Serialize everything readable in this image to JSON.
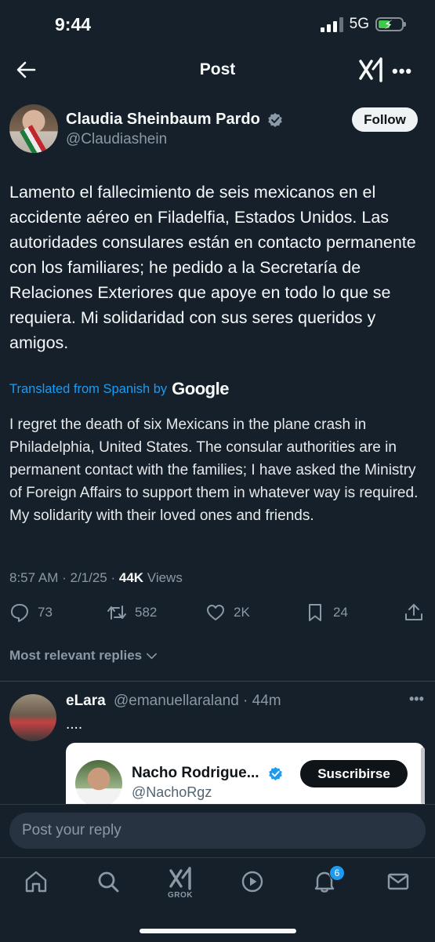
{
  "status_bar": {
    "time": "9:44",
    "network": "5G"
  },
  "header": {
    "title": "Post"
  },
  "post": {
    "author_name": "Claudia Sheinbaum Pardo",
    "author_handle": "@Claudiashein",
    "follow_label": "Follow",
    "text": "Lamento el fallecimiento de seis mexicanos en el accidente aéreo en Filadelfia, Estados Unidos. Las autoridades consulares están en contacto permanente con los familiares; he pedido a la Secretaría de Relaciones Exteriores que apoye en todo lo que se requiera. Mi solidaridad con sus seres queridos y amigos.",
    "translated_label": "Translated from Spanish by",
    "translator_brand": "Google",
    "translation": "I regret the death of six Mexicans in the plane crash in Philadelphia, United States. The consular authorities are in permanent contact with the families; I have asked the Ministry of Foreign Affairs to support them in whatever way is required. My solidarity with their loved ones and friends.",
    "time": "8:57 AM",
    "date": "2/1/25",
    "views_count": "44K",
    "views_label": "Views",
    "replies": "73",
    "reposts": "582",
    "likes": "2K",
    "bookmarks": "24"
  },
  "replies_sort_label": "Most relevant replies",
  "reply": {
    "name": "eLara",
    "handle_time": "@emanuellaraland · 44m",
    "text": "....",
    "embed": {
      "name": "Nacho Rodrigue...",
      "handle": "@NachoRgz",
      "button_label": "Suscribirse"
    }
  },
  "composer": {
    "placeholder": "Post your reply"
  },
  "bottom_nav": {
    "grok_label": "GROK",
    "notification_count": "6"
  },
  "colors": {
    "background": "#15202b",
    "accent": "#1d9bf0",
    "muted": "#8b98a5"
  }
}
